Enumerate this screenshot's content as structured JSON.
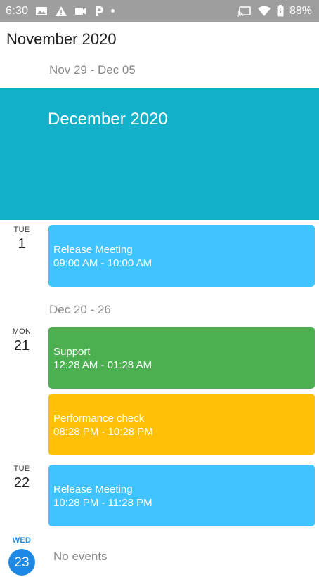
{
  "status_bar": {
    "time": "6:30",
    "battery": "88%",
    "icons": [
      "image-icon",
      "warning-icon",
      "video-icon",
      "parking-icon",
      "dot-icon",
      "cast-icon",
      "wifi-icon",
      "battery-icon"
    ]
  },
  "header": {
    "title": "November 2020"
  },
  "weeks": [
    {
      "label": "Nov 29 - Dec 05"
    },
    {
      "label": "Dec 20 - 26"
    }
  ],
  "month_banner": {
    "label": "December 2020",
    "color": "#12b1c9"
  },
  "days": [
    {
      "dow": "TUE",
      "num": "1"
    },
    {
      "dow": "MON",
      "num": "21"
    },
    {
      "dow": "TUE",
      "num": "22"
    },
    {
      "dow": "WED",
      "num": "23"
    }
  ],
  "events": [
    {
      "name": "Release Meeting",
      "time": "09:00 AM - 10:00 AM",
      "color": "#40c4ff"
    },
    {
      "name": "Support",
      "time": "12:28 AM - 01:28 AM",
      "color": "#4caf50"
    },
    {
      "name": "Performance check",
      "time": "08:28 PM - 10:28 PM",
      "color": "#ffc107"
    },
    {
      "name": "Release Meeting",
      "time": "10:28 PM - 11:28 PM",
      "color": "#40c4ff"
    }
  ],
  "no_events_text": "No events"
}
